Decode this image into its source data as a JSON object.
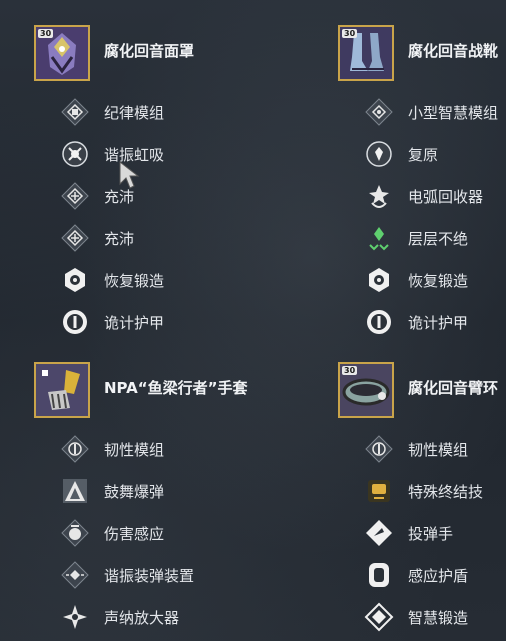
{
  "loadout": {
    "left_top": {
      "power": "30",
      "title": "腐化回音面罩",
      "icon": "helmet-icon",
      "perks": [
        "纪律模组",
        "谐振虹吸",
        "充沛",
        "充沛",
        "恢复锻造",
        "诡计护甲"
      ]
    },
    "right_top": {
      "power": "30",
      "title": "腐化回音战靴",
      "icon": "boots-icon",
      "perks": [
        "小型智慧模组",
        "复原",
        "电弧回收器",
        "层层不绝",
        "恢复锻造",
        "诡计护甲"
      ]
    },
    "left_bottom": {
      "power": "",
      "title": "NPA“鱼梁行者”手套",
      "icon": "gauntlets-icon",
      "perks": [
        "韧性模组",
        "鼓舞爆弹",
        "伤害感应",
        "谐振装弹装置",
        "声纳放大器"
      ]
    },
    "right_bottom": {
      "power": "30",
      "title": "腐化回音臂环",
      "icon": "bond-icon",
      "perks": [
        "韧性模组",
        "特殊终结技",
        "投弹手",
        "感应护盾",
        "智慧锻造"
      ]
    }
  },
  "colors": {
    "exotic_border": "#c9a44a",
    "accent_green": "#5fd06f"
  }
}
